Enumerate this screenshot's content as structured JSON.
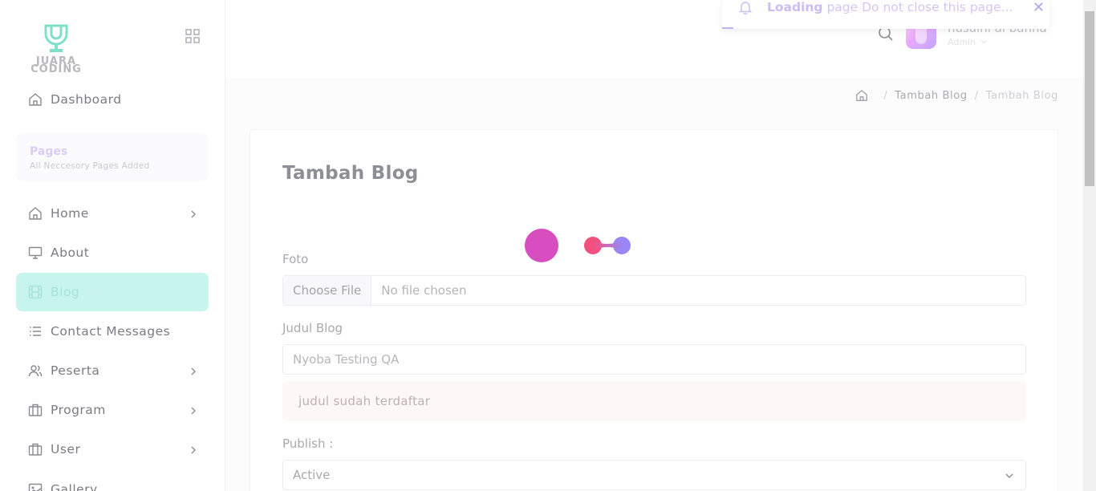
{
  "logo": {
    "line1": "JUARA",
    "line2": "CODING"
  },
  "sidebar": {
    "dashboard": "Dashboard",
    "pages_title": "Pages",
    "pages_subtitle": "All Neccesory Pages Added",
    "items": [
      {
        "label": "Home",
        "icon": "home-icon",
        "has_submenu": true
      },
      {
        "label": "About",
        "icon": "monitor-icon",
        "has_submenu": false
      },
      {
        "label": "Blog",
        "icon": "film-icon",
        "has_submenu": false,
        "active": true
      },
      {
        "label": "Contact Messages",
        "icon": "list-icon",
        "has_submenu": false
      },
      {
        "label": "Peserta",
        "icon": "users-icon",
        "has_submenu": true
      },
      {
        "label": "Program",
        "icon": "briefcase-icon",
        "has_submenu": true
      },
      {
        "label": "User",
        "icon": "briefcase-icon",
        "has_submenu": true
      },
      {
        "label": "Gallery",
        "icon": "image-icon",
        "has_submenu": false
      }
    ]
  },
  "header": {
    "user_name": "husaini al banna",
    "user_role": "Admin"
  },
  "toast": {
    "strong": "Loading",
    "message": " page Do not close this page...",
    "close": "✕"
  },
  "breadcrumb": {
    "link": "Tambah Blog",
    "current": "Tambah Blog"
  },
  "form": {
    "title": "Tambah Blog",
    "foto_label": "Foto",
    "file_button": "Choose File",
    "file_name": "No file chosen",
    "judul_label": "Judul Blog",
    "judul_value": "Nyoba Testing QA",
    "error": "judul sudah terdaftar",
    "publish_label": "Publish :",
    "publish_value": "Active"
  },
  "colors": {
    "accent": "#c8f4ee",
    "loader_magenta": "#d84ec0",
    "loader_pink": "#f2507e",
    "loader_violet": "#9a86f5",
    "toast_text": "#cbbcf3"
  }
}
